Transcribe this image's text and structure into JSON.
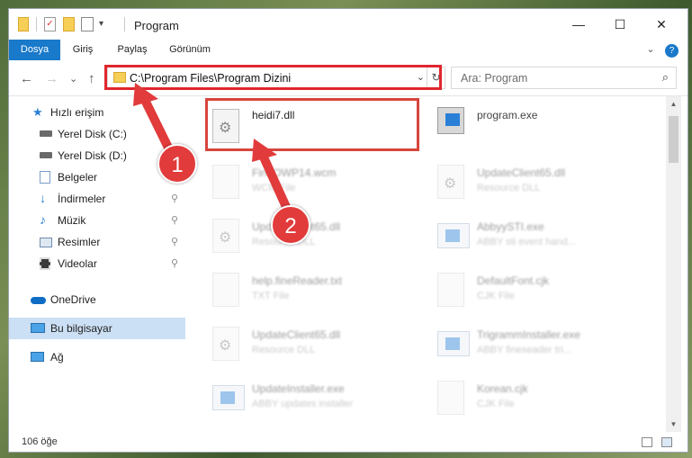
{
  "window": {
    "title": "Program",
    "controls": [
      "—",
      "☐",
      "✕"
    ]
  },
  "ribbon": {
    "tabs": [
      "Dosya",
      "Giriş",
      "Paylaş",
      "Görünüm"
    ],
    "collapse": "⌄",
    "help": "?"
  },
  "nav_buttons": {
    "back": "←",
    "forward": "→",
    "recent": "⌄",
    "up": "↑"
  },
  "address": {
    "path": "C:\\Program Files\\Program Dizini",
    "dropdown": "⌄",
    "refresh": "↻"
  },
  "search": {
    "placeholder": "Ara: Program",
    "icon": "search-icon"
  },
  "sidebar": {
    "items": [
      {
        "label": "Hızlı erişim",
        "icon": "star-icon",
        "pinned": false
      },
      {
        "label": "Yerel Disk (C:)",
        "icon": "drive-icon",
        "pinned": false
      },
      {
        "label": "Yerel Disk (D:)",
        "icon": "drive-icon",
        "pinned": false
      },
      {
        "label": "Belgeler",
        "icon": "documents-icon",
        "pinned": false
      },
      {
        "label": "İndirmeler",
        "icon": "download-icon",
        "pinned": true
      },
      {
        "label": "Müzik",
        "icon": "music-icon",
        "pinned": true
      },
      {
        "label": "Resimler",
        "icon": "pictures-icon",
        "pinned": true
      },
      {
        "label": "Videolar",
        "icon": "video-icon",
        "pinned": true
      },
      {
        "label": "OneDrive",
        "icon": "cloud-icon",
        "pinned": false
      },
      {
        "label": "Bu bilgisayar",
        "icon": "computer-icon",
        "pinned": false,
        "selected": true
      },
      {
        "label": "Ağ",
        "icon": "network-icon",
        "pinned": false
      }
    ],
    "pin_glyph": "📌"
  },
  "files": [
    {
      "name": "heidi7.dll",
      "type": "",
      "kind": "dll",
      "highlighted": true
    },
    {
      "name": "program.exe",
      "type": "",
      "kind": "exe"
    },
    {
      "name": "FineOWP14.wcm",
      "type": "WCM File",
      "kind": "doc"
    },
    {
      "name": "UpdateClient65.dll",
      "type": "Resource DLL",
      "kind": "dll"
    },
    {
      "name": "UpdateClient65.dll",
      "type": "Resource DLL",
      "kind": "dll"
    },
    {
      "name": "AbbyySTI.exe",
      "type": "ABBY sti event hand...",
      "kind": "exe"
    },
    {
      "name": "help.fineReader.txt",
      "type": "TXT File",
      "kind": "doc"
    },
    {
      "name": "DefaultFont.cjk",
      "type": "CJK File",
      "kind": "doc"
    },
    {
      "name": "UpdateClient65.dll",
      "type": "Resource DLL",
      "kind": "dll"
    },
    {
      "name": "TrigrammInstaller.exe",
      "type": "ABBY fineseader tri...",
      "kind": "exe"
    },
    {
      "name": "UpdateInstaller.exe",
      "type": "ABBY updates installer",
      "kind": "exe"
    },
    {
      "name": "Korean.cjk",
      "type": "CJK File",
      "kind": "doc"
    }
  ],
  "status": {
    "count": "106 öğe"
  },
  "annotations": {
    "callout_1": "1",
    "callout_2": "2",
    "color": "#e23b3b"
  }
}
